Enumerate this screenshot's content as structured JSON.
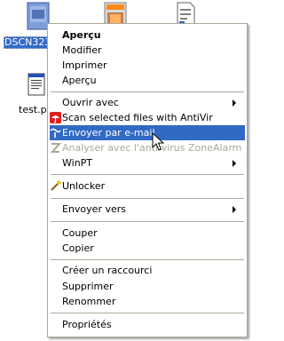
{
  "desktop": {
    "icons": [
      {
        "label": "DSCN323",
        "selected": true
      },
      {
        "label": "",
        "selected": false
      },
      {
        "label": "",
        "selected": false
      },
      {
        "label": "test.p",
        "selected": false
      }
    ]
  },
  "context_menu": {
    "items": [
      {
        "label": "Aperçu",
        "bold": true
      },
      {
        "label": "Modifier"
      },
      {
        "label": "Imprimer"
      },
      {
        "label": "Aperçu"
      },
      {
        "label": "Ouvrir avec",
        "submenu": true
      },
      {
        "label": "Scan selected files with AntiVir",
        "icon": "antivir-umbrella-icon"
      },
      {
        "label": "Envoyer par e-mail",
        "icon": "email-send-icon",
        "highlighted": true
      },
      {
        "label": "Analyser avec l'anti-virus ZoneAlarm",
        "icon": "zonealarm-icon",
        "disabled": true
      },
      {
        "label": "WinPT",
        "submenu": true
      },
      {
        "label": "Unlocker",
        "icon": "unlocker-wand-icon"
      },
      {
        "label": "Envoyer vers",
        "submenu": true
      },
      {
        "label": "Couper"
      },
      {
        "label": "Copier"
      },
      {
        "label": "Créer un raccourci"
      },
      {
        "label": "Supprimer"
      },
      {
        "label": "Renommer"
      },
      {
        "label": "Propriétés"
      }
    ]
  },
  "colors": {
    "highlight": "#316ac5",
    "menu_border": "#aca899",
    "disabled_text": "#aca899",
    "antivir_red": "#e02020"
  }
}
